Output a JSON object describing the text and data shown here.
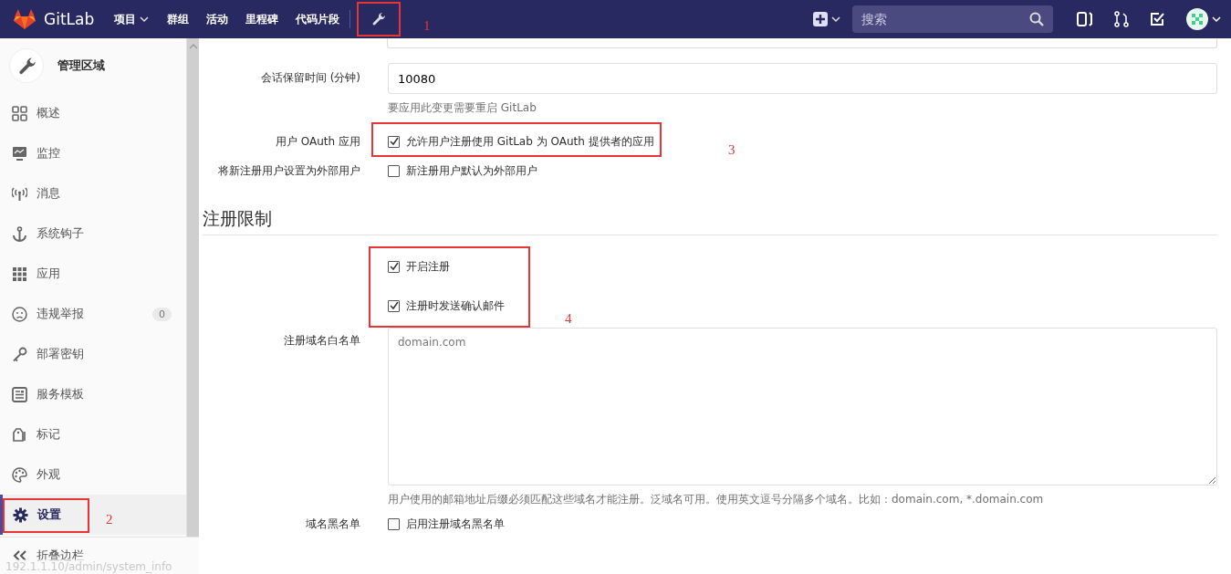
{
  "navbar": {
    "brand": "GitLab",
    "links": [
      {
        "label": "项目",
        "dropdown": true
      },
      {
        "label": "群组",
        "dropdown": false
      },
      {
        "label": "活动",
        "dropdown": false
      },
      {
        "label": "里程碑",
        "dropdown": false
      },
      {
        "label": "代码片段",
        "dropdown": false
      }
    ],
    "search": {
      "placeholder": "搜索"
    }
  },
  "sidebar": {
    "title": "管理区域",
    "items": [
      {
        "label": "概述",
        "selected": false
      },
      {
        "label": "监控",
        "selected": false
      },
      {
        "label": "消息",
        "selected": false
      },
      {
        "label": "系统钩子",
        "selected": false
      },
      {
        "label": "应用",
        "selected": false
      },
      {
        "label": "违规举报",
        "selected": false,
        "badge": "0"
      },
      {
        "label": "部署密钥",
        "selected": false
      },
      {
        "label": "服务模板",
        "selected": false
      },
      {
        "label": "标记",
        "selected": false
      },
      {
        "label": "外观",
        "selected": false
      },
      {
        "label": "设置",
        "selected": true
      }
    ],
    "collapse": "折叠边栏"
  },
  "form": {
    "session": {
      "label": "会话保留时间 (分钟)",
      "value": "10080",
      "help": "要应用此变更需要重启 GitLab"
    },
    "oauth": {
      "label": "用户 OAuth 应用",
      "checkbox": "允许用户注册使用 GitLab 为 OAuth 提供者的应用",
      "checked": true
    },
    "external": {
      "label": "将新注册用户设置为外部用户",
      "checkbox": "新注册用户默认为外部用户",
      "checked": false
    },
    "section": "注册限制",
    "signup": [
      {
        "label": "开启注册",
        "checked": true
      },
      {
        "label": "注册时发送确认邮件",
        "checked": true
      }
    ],
    "whitelist": {
      "label": "注册域名白名单",
      "placeholder": "domain.com",
      "help": "用户使用的邮箱地址后缀必须匹配这些域名才能注册。泛域名可用。使用英文逗号分隔多个域名。比如：domain.com, *.domain.com"
    },
    "blacklist": {
      "label": "域名黑名单",
      "checkbox": "启用注册域名黑名单",
      "checked": false
    }
  },
  "annotations": [
    "1",
    "2",
    "3",
    "4"
  ],
  "status_url": "192.1.1.10/admin/system_info"
}
